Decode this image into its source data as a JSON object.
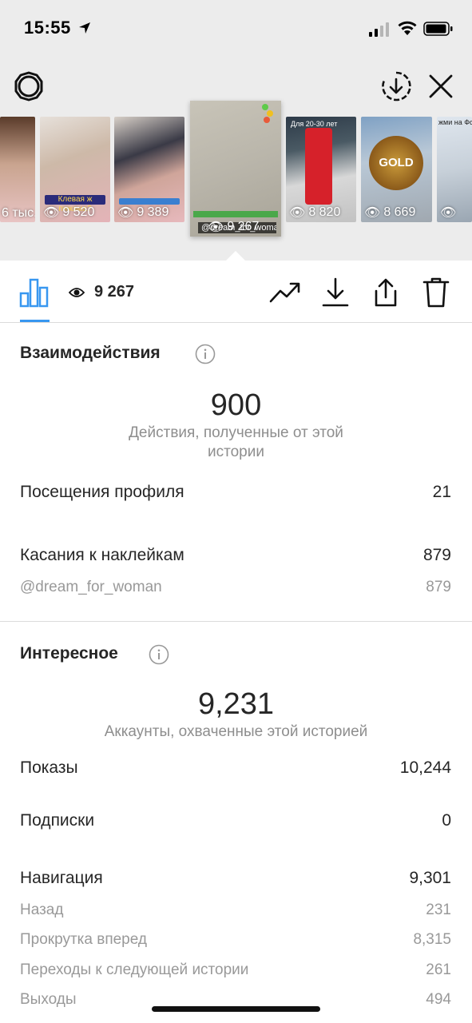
{
  "status": {
    "time": "15:55"
  },
  "thumbnails": [
    {
      "views": "6 тыс.",
      "caption": ""
    },
    {
      "views": "9 520",
      "caption": "Клевая ж пижама?"
    },
    {
      "views": "9 389",
      "caption": ""
    },
    {
      "views": "8 820",
      "caption": "Для 20-30 лет"
    },
    {
      "views": "8 669",
      "caption": "GOLD"
    },
    {
      "views": "",
      "caption": "жми на Фото д"
    }
  ],
  "selected": {
    "views": "9 267",
    "tag": "@dream_for_woman"
  },
  "toolbar": {
    "view_count": "9 267"
  },
  "interactions": {
    "title": "Взаимодействия",
    "total": "900",
    "total_label": "Действия, полученные от этой истории",
    "rows": [
      {
        "label": "Посещения профиля",
        "value": "21"
      },
      {
        "label": "Касания к наклейкам",
        "value": "879"
      },
      {
        "label": "@dream_for_woman",
        "value": "879"
      }
    ]
  },
  "discovery": {
    "title": "Интересное",
    "total": "9,231",
    "total_label": "Аккаунты, охваченные этой историей",
    "rows": [
      {
        "label": "Показы",
        "value": "10,244"
      },
      {
        "label": "Подписки",
        "value": "0"
      },
      {
        "label": "Навигация",
        "value": "9,301"
      },
      {
        "label": "Назад",
        "value": "231"
      },
      {
        "label": "Прокрутка вперед",
        "value": "8,315"
      },
      {
        "label": "Переходы к следующей истории",
        "value": "261"
      },
      {
        "label": "Выходы",
        "value": "494"
      }
    ]
  },
  "colors": {
    "accent": "#3897f0",
    "muted": "#8e8e8e",
    "text": "#262626"
  }
}
